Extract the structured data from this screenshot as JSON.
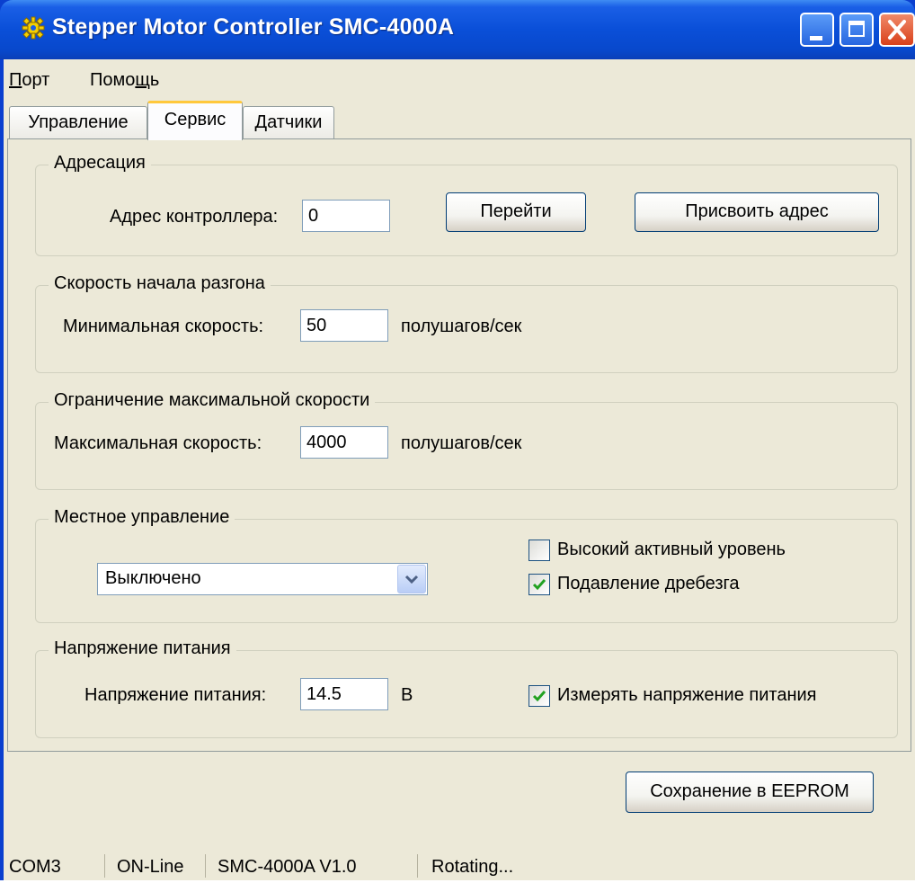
{
  "window": {
    "title": "Stepper Motor Controller SMC-4000A",
    "icon": "gear-icon"
  },
  "menu": {
    "port": {
      "accel": "П",
      "rest": "орт"
    },
    "help": {
      "before": "Помо",
      "accel": "щ",
      "after": "ь"
    }
  },
  "tabs": [
    {
      "label": "Управление",
      "active": false
    },
    {
      "label": "Сервис",
      "active": true
    },
    {
      "label": "Датчики",
      "active": false
    }
  ],
  "addressing": {
    "legend": "Адресация",
    "address_label": "Адрес контроллера:",
    "address_value": "0",
    "go_button": "Перейти",
    "assign_button": "Присвоить адрес"
  },
  "accel_start": {
    "legend": "Скорость начала разгона",
    "min_speed_label": "Минимальная скорость:",
    "min_speed_value": "50",
    "unit": "полушагов/сек"
  },
  "max_speed_limit": {
    "legend": "Ограничение максимальной скорости",
    "max_speed_label": "Максимальная скорость:",
    "max_speed_value": "4000",
    "unit": "полушагов/сек"
  },
  "local_control": {
    "legend": "Местное управление",
    "mode_selected": "Выключено",
    "high_active_label": "Высокий активный уровень",
    "high_active_checked": false,
    "debounce_label": "Подавление дребезга",
    "debounce_checked": true
  },
  "supply_voltage": {
    "legend": "Напряжение питания",
    "voltage_label": "Напряжение питания:",
    "voltage_value": "14.5",
    "unit": "В",
    "measure_label": "Измерять напряжение питания",
    "measure_checked": true
  },
  "save_button": "Сохранение в EEPROM",
  "statusbar": {
    "port": "COM3",
    "connection": "ON-Line",
    "device": "SMC-4000A V1.0",
    "state": "Rotating..."
  },
  "colors": {
    "title_bar": "#0a4fd8",
    "face": "#ece9d8",
    "check_mark": "#21a121",
    "close_button": "#d9401a",
    "active_tab_highlight": "#ffc83c"
  }
}
